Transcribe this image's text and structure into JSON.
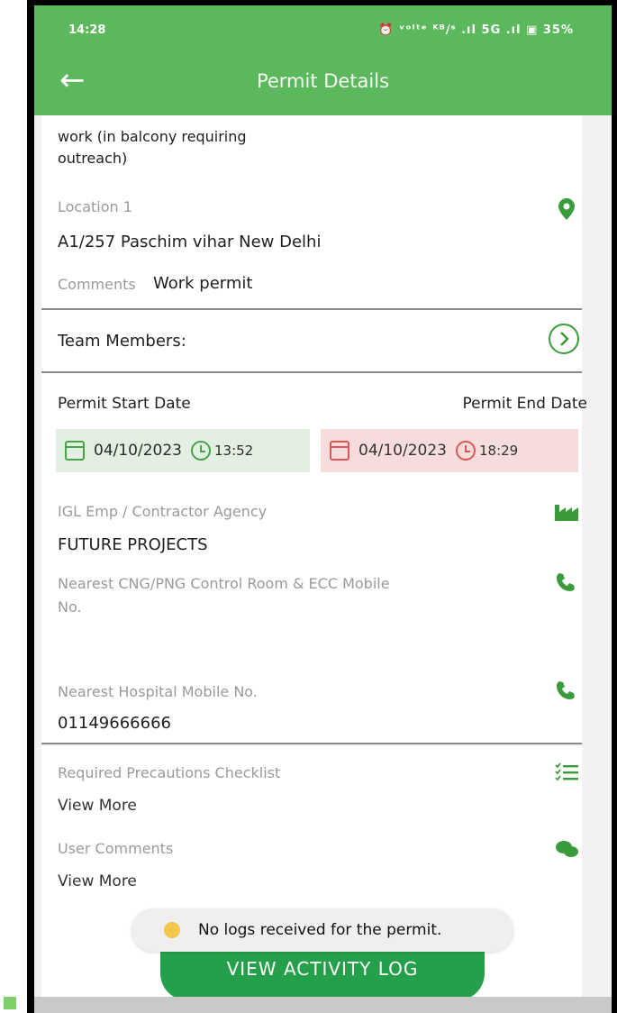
{
  "status_bar": {
    "time": "14:28",
    "indicators": "⏰ ᵛᵒˡᵗᵉ ᴷᴮ/ˢ .ıl 5G .ıl ▣ 35%"
  },
  "app_bar": {
    "back_icon": "arrow-left-icon",
    "title": "Permit Details"
  },
  "section1": {
    "work_text_line1": "work (in balcony requiring",
    "work_text_line2": "outreach)",
    "location_label": "Location 1",
    "location_value": "A1/257 Paschim vihar New Delhi",
    "comments_label": "Comments",
    "comments_value": "Work permit"
  },
  "team": {
    "label": "Team Members:"
  },
  "dates": {
    "start_label": "Permit Start Date",
    "end_label": "Permit End Date",
    "start_date": "04/10/2023",
    "start_time": "13:52",
    "end_date": "04/10/2023",
    "end_time": "18:29"
  },
  "agency": {
    "label": "IGL Emp / Contractor Agency",
    "value": "FUTURE PROJECTS"
  },
  "control_room": {
    "label_line1": "Nearest CNG/PNG Control Room & ECC Mobile",
    "label_line2": "No."
  },
  "hospital": {
    "label": "Nearest Hospital Mobile No.",
    "value": "01149666666"
  },
  "precautions": {
    "label": "Required Precautions Checklist",
    "link": "View More"
  },
  "user_comments": {
    "label": "User Comments",
    "link": "View More"
  },
  "toast": {
    "text": "No logs received for the permit."
  },
  "activity_button": {
    "label": "VIEW ACTIVITY LOG"
  },
  "colors": {
    "primary": "#5cb85c",
    "button": "#25a04a",
    "start_bg": "#e3efe3",
    "end_bg": "#f7dcdc"
  }
}
